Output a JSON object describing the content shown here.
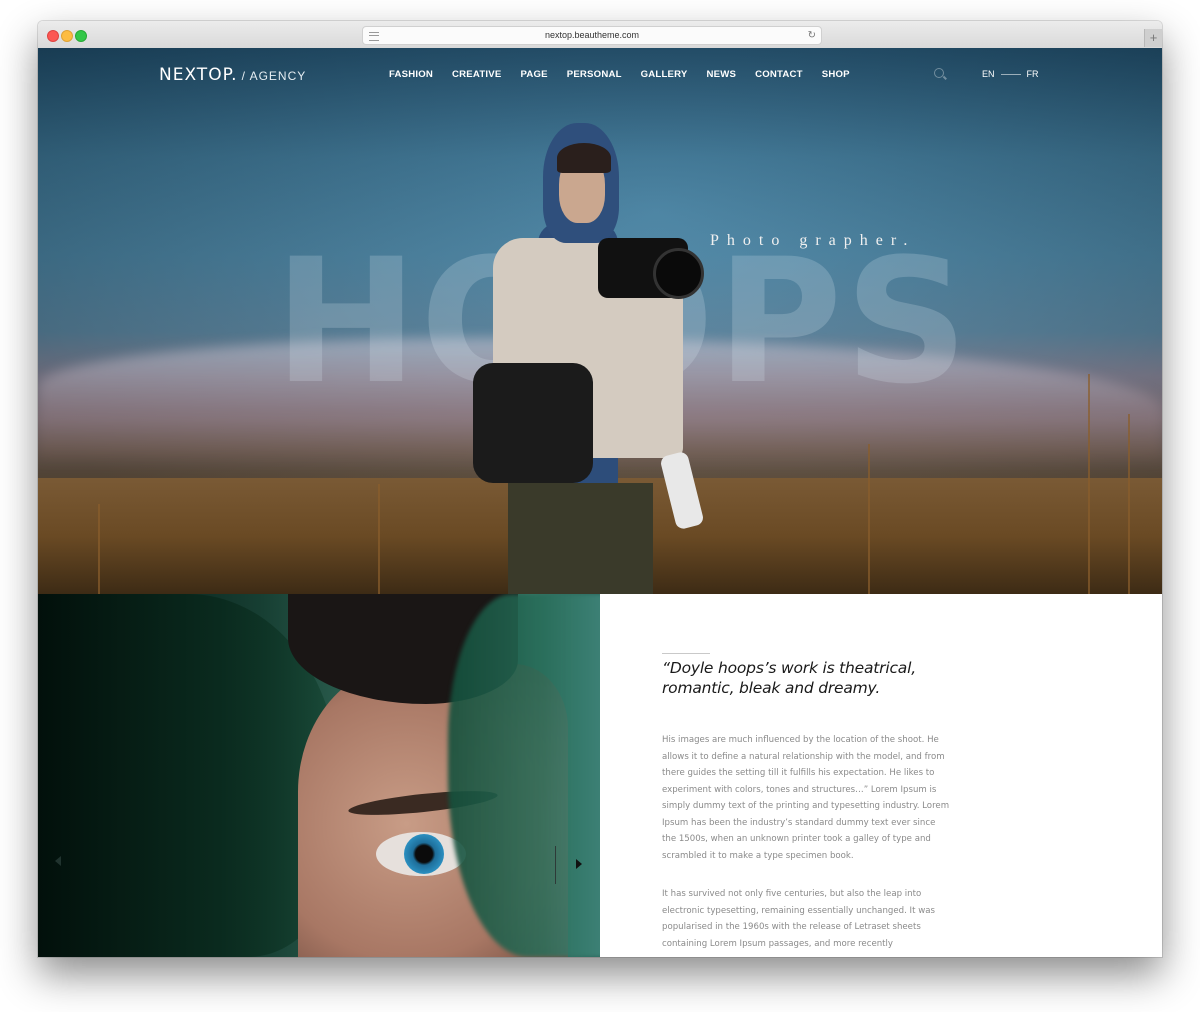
{
  "browser": {
    "url": "nextop.beautheme.com",
    "new_tab_symbol": "+",
    "reload_symbol": "↻"
  },
  "site": {
    "brand": "NEXTOP.",
    "brand_tag": "/ AGENCY",
    "menu": [
      "FASHION",
      "CREATIVE",
      "PAGE",
      "PERSONAL",
      "GALLERY",
      "NEWS",
      "CONTACT",
      "SHOP"
    ],
    "languages": [
      "EN",
      "FR"
    ]
  },
  "hero": {
    "big_word": "HOOPS",
    "subtitle": "Photo grapher."
  },
  "slider": {
    "prev_icon": "triangle-left",
    "next_icon": "triangle-right"
  },
  "article": {
    "quote": "“Doyle hoops’s work is theatrical, romantic, bleak and dreamy.",
    "paragraphs": [
      "His images are much influenced by the location of the shoot. He allows it to define a natural relationship with the model, and from there guides the setting till it fulfills his expectation. He likes to experiment with colors, tones and structures…” Lorem Ipsum is simply dummy text of the printing and typesetting industry. Lorem Ipsum has been the industry’s standard dummy text ever since the 1500s, when an unknown printer took a galley of type and scrambled it to make a type specimen book.",
      "It has survived not only five centuries, but also the leap into electronic typesetting, remaining essentially unchanged. It was popularised in the 1960s with the release of Letraset sheets containing Lorem Ipsum passages, and more recently"
    ]
  },
  "colors": {
    "nav_text": "#ffffff",
    "quote_text": "#1a1a1a",
    "body_text": "#8a8a8a"
  }
}
